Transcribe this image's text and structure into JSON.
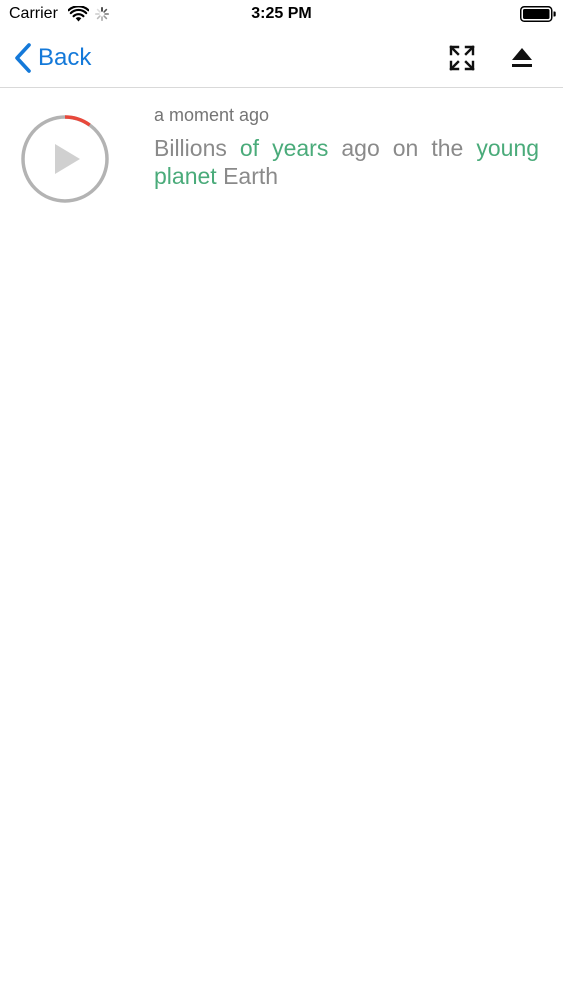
{
  "status_bar": {
    "carrier": "Carrier",
    "time": "3:25 PM",
    "icons": [
      "wifi-icon",
      "activity-spinner-icon",
      "battery-icon"
    ]
  },
  "nav_bar": {
    "back_label": "Back",
    "back_icon": "chevron-left-icon",
    "actions": [
      "expand-icon",
      "eject-icon"
    ],
    "accent_color": "#1479d9"
  },
  "message": {
    "timestamp": "a moment ago",
    "playback_progress": 0.1,
    "progress_color": "#e8483b",
    "highlight_color": "#4aab7a",
    "words": [
      {
        "text": "Billions",
        "highlight": false
      },
      {
        "text": "of",
        "highlight": true
      },
      {
        "text": "years",
        "highlight": true
      },
      {
        "text": "ago",
        "highlight": false
      },
      {
        "text": "on",
        "highlight": false
      },
      {
        "text": "the",
        "highlight": false
      },
      {
        "text": "young",
        "highlight": true
      },
      {
        "text": "planet",
        "highlight": true
      },
      {
        "text": "Earth",
        "highlight": false
      }
    ]
  }
}
